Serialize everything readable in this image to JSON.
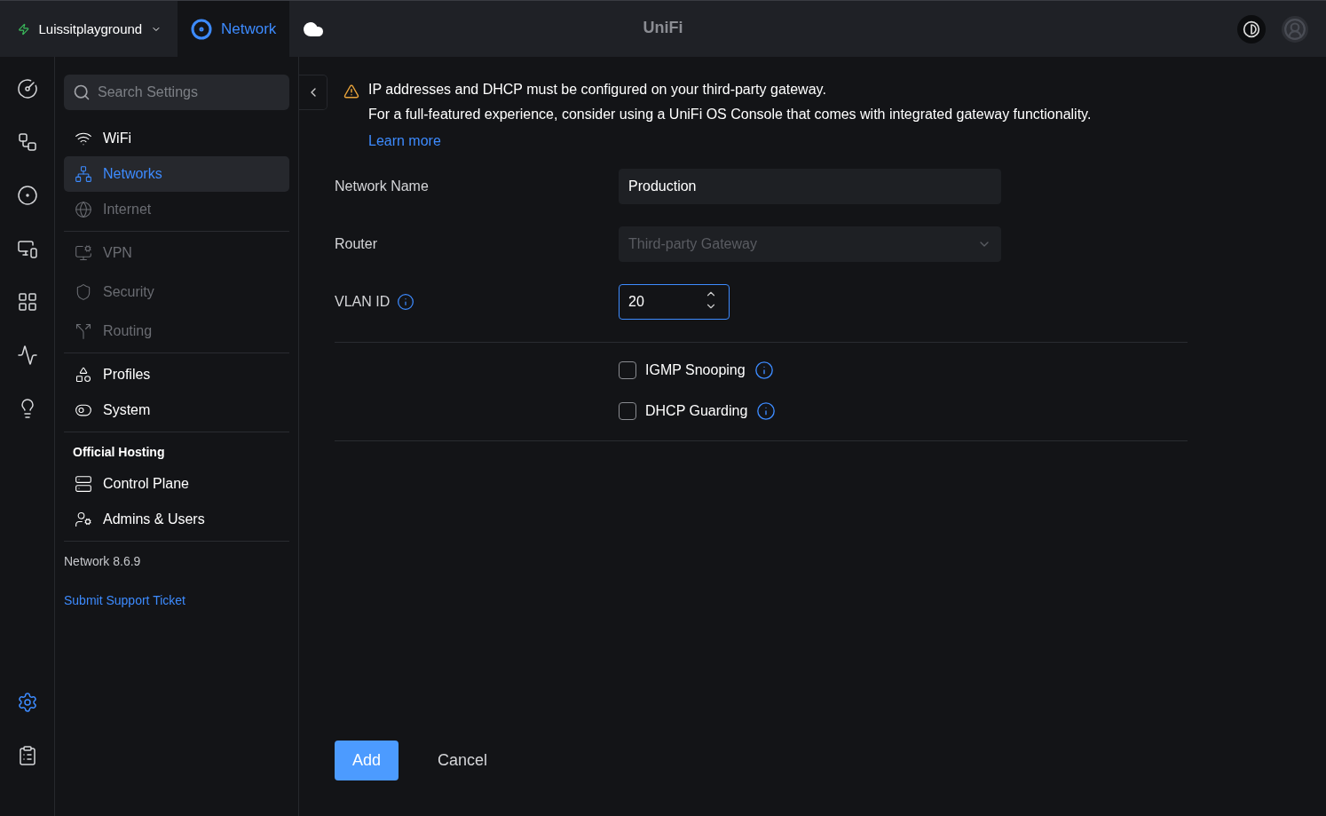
{
  "topbar": {
    "site": "Luissitplayground",
    "tabs": [
      {
        "kind": "app",
        "label": "Network",
        "selected": true
      },
      {
        "kind": "icon",
        "selected": false
      }
    ],
    "logo": "UniFi"
  },
  "rail": {
    "top": [
      {
        "selected": false
      },
      {
        "selected": false
      },
      {
        "selected": false
      },
      {
        "selected": false
      },
      {
        "selected": false
      },
      {
        "selected": false
      },
      {
        "selected": false
      }
    ],
    "bottom": [
      {
        "selected": true
      },
      {
        "selected": false
      }
    ]
  },
  "sidebar": {
    "search": {
      "placeholder": "Search Settings"
    },
    "groups": [
      {
        "items": [
          {
            "label": "WiFi",
            "selected": false,
            "disabled": false
          },
          {
            "label": "Networks",
            "selected": true,
            "disabled": false
          },
          {
            "label": "Internet",
            "selected": false,
            "disabled": true
          }
        ]
      },
      {
        "items": [
          {
            "label": "VPN",
            "selected": false,
            "disabled": true
          },
          {
            "label": "Security",
            "selected": false,
            "disabled": true
          },
          {
            "label": "Routing",
            "selected": false,
            "disabled": true
          }
        ]
      },
      {
        "items": [
          {
            "label": "Profiles",
            "selected": false,
            "disabled": false
          },
          {
            "label": "System",
            "selected": false,
            "disabled": false
          }
        ]
      },
      {
        "heading": "Official Hosting",
        "items": [
          {
            "label": "Control Plane",
            "selected": false,
            "disabled": false
          },
          {
            "label": "Admins & Users",
            "selected": false,
            "disabled": false
          }
        ]
      }
    ],
    "version": "Network 8.6.9",
    "support_link": "Submit Support Ticket"
  },
  "alert": {
    "lines": [
      "IP addresses and DHCP must be configured on your third-party gateway.",
      "For a full-featured experience, consider using a UniFi OS Console that comes with integrated gateway functionality."
    ],
    "link": "Learn more"
  },
  "form": {
    "fields": [
      {
        "kind": "text",
        "label": "Network Name",
        "value": "Production",
        "disabled": false
      },
      {
        "kind": "select",
        "label": "Router",
        "value": "Third-party Gateway",
        "disabled": true
      },
      {
        "kind": "number",
        "label": "VLAN ID",
        "value": "20",
        "disabled": false,
        "info": true
      }
    ],
    "options": [
      {
        "label": "IGMP Snooping",
        "checked": false
      },
      {
        "label": "DHCP Guarding",
        "checked": false
      }
    ]
  },
  "buttons": [
    {
      "kind": "primary",
      "label": "Add"
    },
    {
      "kind": "plain",
      "label": "Cancel"
    }
  ]
}
